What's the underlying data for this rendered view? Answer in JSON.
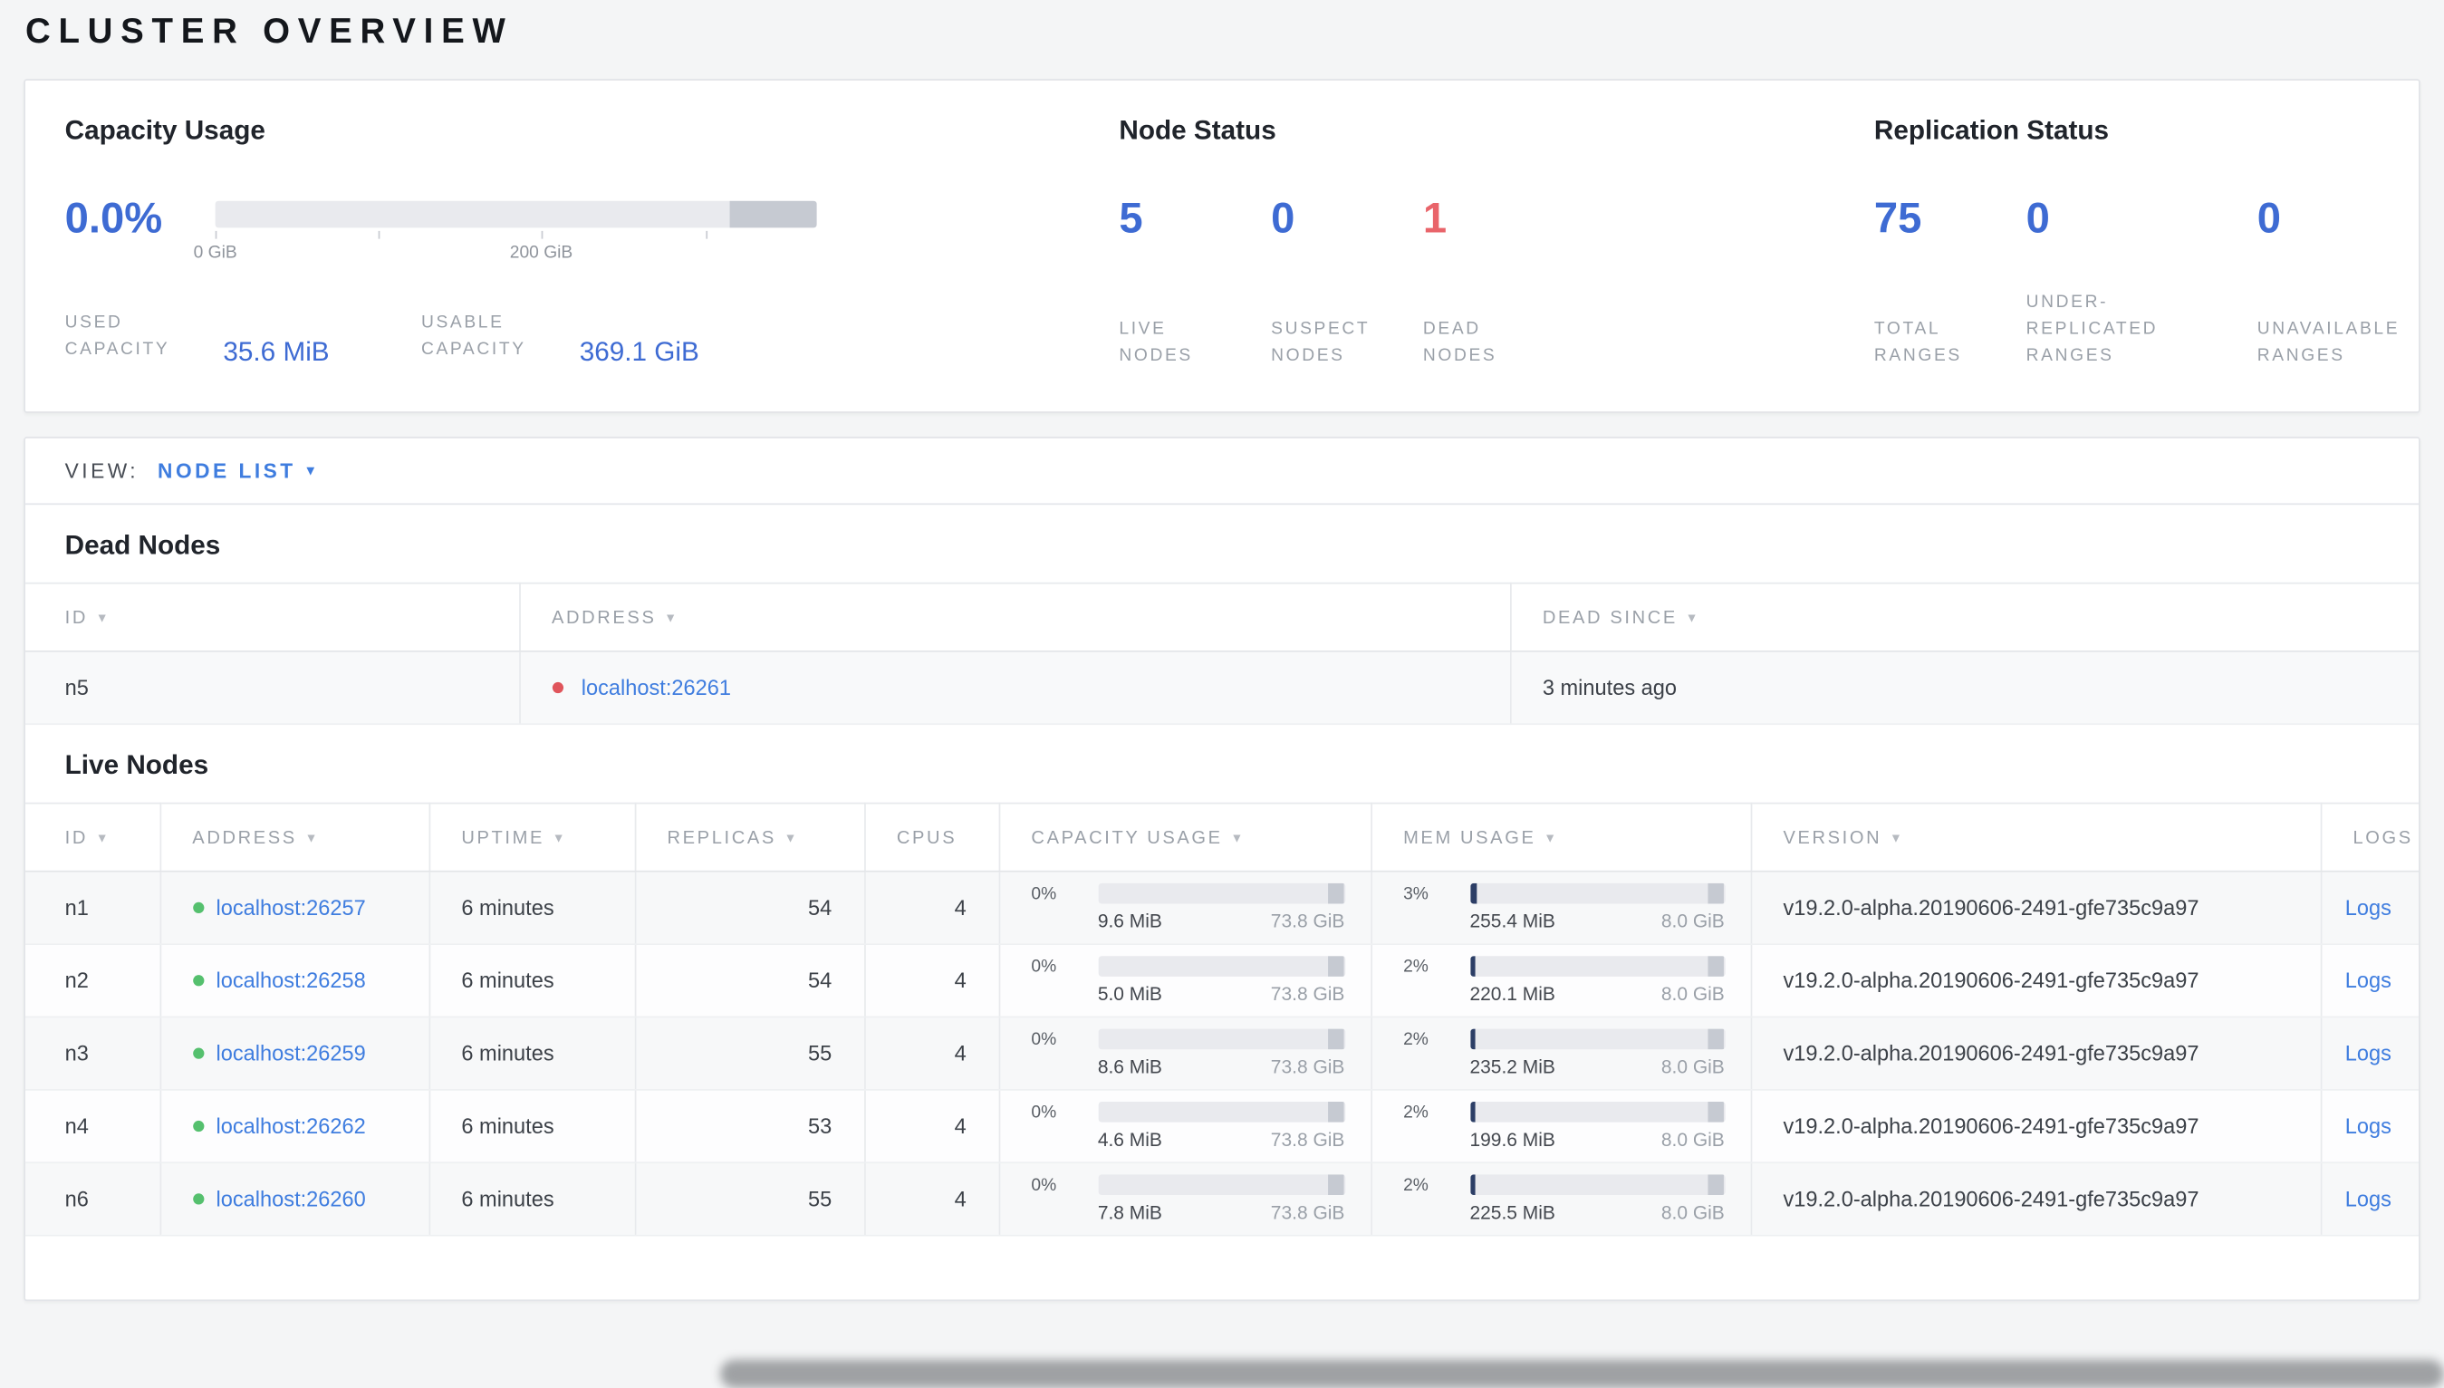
{
  "page_title": "CLUSTER OVERVIEW",
  "summary": {
    "capacity": {
      "title": "Capacity Usage",
      "percent": "0.0%",
      "axis_tick_0": "0 GiB",
      "axis_tick_1": "200 GiB",
      "bar_fill_pct": 0,
      "used_label": "USED\nCAPACITY",
      "used_value": "35.6 MiB",
      "usable_label": "USABLE\nCAPACITY",
      "usable_value": "369.1 GiB"
    },
    "node_status": {
      "title": "Node Status",
      "stats": [
        {
          "value": "5",
          "label": "LIVE\nNODES"
        },
        {
          "value": "0",
          "label": "SUSPECT\nNODES"
        },
        {
          "value": "1",
          "label": "DEAD\nNODES"
        }
      ]
    },
    "replication": {
      "title": "Replication Status",
      "stats": [
        {
          "value": "75",
          "label": "TOTAL\nRANGES"
        },
        {
          "value": "0",
          "label": "UNDER-\nREPLICATED\nRANGES"
        },
        {
          "value": "0",
          "label": "UNAVAILABLE\nRANGES"
        }
      ]
    }
  },
  "view_bar": {
    "label": "VIEW:",
    "selected": "NODE LIST",
    "caret": "▾"
  },
  "dead_nodes": {
    "title": "Dead Nodes",
    "columns": [
      "ID",
      "ADDRESS",
      "DEAD SINCE"
    ],
    "rows": [
      {
        "id": "n5",
        "address": "localhost:26261",
        "dead_since": "3 minutes ago"
      }
    ]
  },
  "live_nodes": {
    "title": "Live Nodes",
    "columns": [
      {
        "label": "ID"
      },
      {
        "label": "ADDRESS"
      },
      {
        "label": "UPTIME"
      },
      {
        "label": "REPLICAS"
      },
      {
        "label": "CPUS"
      },
      {
        "label": "CAPACITY USAGE"
      },
      {
        "label": "MEM USAGE"
      },
      {
        "label": "VERSION"
      },
      {
        "label": "LOGS"
      }
    ],
    "rows": [
      {
        "id": "n1",
        "address": "localhost:26257",
        "uptime": "6 minutes",
        "replicas": "54",
        "cpus": "4",
        "capacity_percent": "0%",
        "capacity_fill": 0,
        "capacity_used": "9.6 MiB",
        "capacity_total": "73.8 GiB",
        "mem_percent": "3%",
        "mem_fill": 3,
        "mem_used": "255.4 MiB",
        "mem_total": "8.0 GiB",
        "version": "v19.2.0-alpha.20190606-2491-gfe735c9a97",
        "logs": "Logs"
      },
      {
        "id": "n2",
        "address": "localhost:26258",
        "uptime": "6 minutes",
        "replicas": "54",
        "cpus": "4",
        "capacity_percent": "0%",
        "capacity_fill": 0,
        "capacity_used": "5.0 MiB",
        "capacity_total": "73.8 GiB",
        "mem_percent": "2%",
        "mem_fill": 2,
        "mem_used": "220.1 MiB",
        "mem_total": "8.0 GiB",
        "version": "v19.2.0-alpha.20190606-2491-gfe735c9a97",
        "logs": "Logs"
      },
      {
        "id": "n3",
        "address": "localhost:26259",
        "uptime": "6 minutes",
        "replicas": "55",
        "cpus": "4",
        "capacity_percent": "0%",
        "capacity_fill": 0,
        "capacity_used": "8.6 MiB",
        "capacity_total": "73.8 GiB",
        "mem_percent": "2%",
        "mem_fill": 2,
        "mem_used": "235.2 MiB",
        "mem_total": "8.0 GiB",
        "version": "v19.2.0-alpha.20190606-2491-gfe735c9a97",
        "logs": "Logs"
      },
      {
        "id": "n4",
        "address": "localhost:26262",
        "uptime": "6 minutes",
        "replicas": "53",
        "cpus": "4",
        "capacity_percent": "0%",
        "capacity_fill": 0,
        "capacity_used": "4.6 MiB",
        "capacity_total": "73.8 GiB",
        "mem_percent": "2%",
        "mem_fill": 2,
        "mem_used": "199.6 MiB",
        "mem_total": "8.0 GiB",
        "version": "v19.2.0-alpha.20190606-2491-gfe735c9a97",
        "logs": "Logs"
      },
      {
        "id": "n6",
        "address": "localhost:26260",
        "uptime": "6 minutes",
        "replicas": "55",
        "cpus": "4",
        "capacity_percent": "0%",
        "capacity_fill": 0,
        "capacity_used": "7.8 MiB",
        "capacity_total": "73.8 GiB",
        "mem_percent": "2%",
        "mem_fill": 2,
        "mem_used": "225.5 MiB",
        "mem_total": "8.0 GiB",
        "version": "v19.2.0-alpha.20190606-2491-gfe735c9a97",
        "logs": "Logs"
      }
    ]
  }
}
